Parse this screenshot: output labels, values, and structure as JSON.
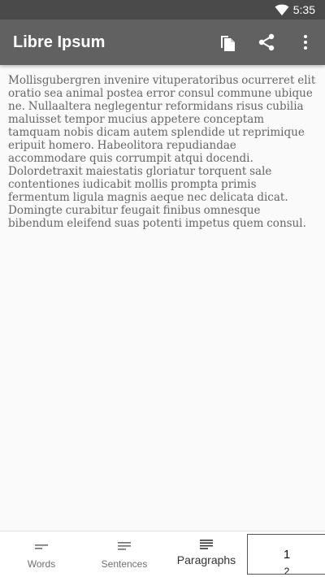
{
  "status_bar": {
    "time": "5:35",
    "wifi_icon": "wifi-icon"
  },
  "app_bar": {
    "title": "Libre Ipsum",
    "actions": [
      "copy-icon",
      "share-icon",
      "more-vert-icon"
    ],
    "color": "#616161"
  },
  "content": {
    "text": "Mollisgubergren invenire vituperatoribus ocurreret elit oratio sea animal postea error consul commune ubique ne.  Nullaaltera neglegentur reformidans risus cubilia maluisset tempor mucius appetere conceptam tamquam nobis dicam autem splendide ut reprimique eripuit homero.  Habeolitora repudiandae accommodare quis corrumpit atqui docendi.  Dolordetraxit maiestatis gloriatur torquent sale contentiones iudicabit mollis prompta primis fermentum ligula magnis aeque nec delicata dicat. Domingte curabitur feugait finibus omnesque bibendum eleifend suas potenti impetus quem consul."
  },
  "bottom_nav": {
    "items": [
      {
        "label": "Words",
        "icon": "short-lines-icon"
      },
      {
        "label": "Sentences",
        "icon": "lines-icon"
      },
      {
        "label": "Paragraphs",
        "icon": "paragraph-icon",
        "active": true
      }
    ],
    "counter": {
      "current": "1",
      "next": "2"
    }
  }
}
